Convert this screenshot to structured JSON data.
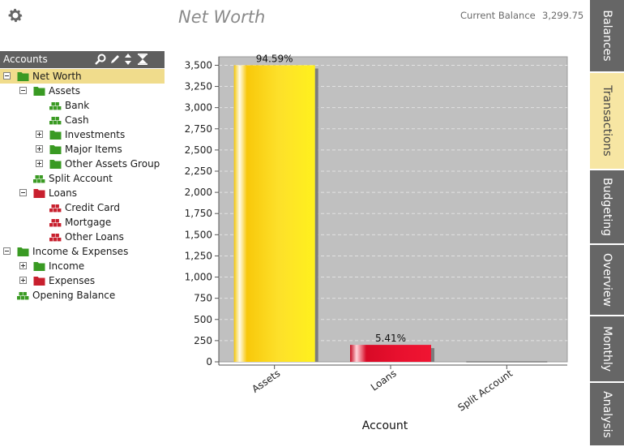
{
  "header": {
    "title": "Net Worth",
    "balance_label": "Current Balance",
    "balance_value": "3,299.75"
  },
  "accounts_panel": {
    "title": "Accounts"
  },
  "tree": [
    {
      "label": "Net Worth",
      "level": 0,
      "toggle": "minus",
      "icon": "folder",
      "color": "green",
      "selected": true
    },
    {
      "label": "Assets",
      "level": 1,
      "toggle": "minus",
      "icon": "folder",
      "color": "green"
    },
    {
      "label": "Bank",
      "level": 2,
      "toggle": "none",
      "icon": "account",
      "color": "green"
    },
    {
      "label": "Cash",
      "level": 2,
      "toggle": "none",
      "icon": "account",
      "color": "green"
    },
    {
      "label": "Investments",
      "level": 2,
      "toggle": "plus",
      "icon": "folder",
      "color": "green"
    },
    {
      "label": "Major Items",
      "level": 2,
      "toggle": "plus",
      "icon": "folder",
      "color": "green"
    },
    {
      "label": "Other Assets Group",
      "level": 2,
      "toggle": "plus",
      "icon": "folder",
      "color": "green"
    },
    {
      "label": "Split Account",
      "level": 1,
      "toggle": "none",
      "icon": "account",
      "color": "green"
    },
    {
      "label": "Loans",
      "level": 1,
      "toggle": "minus",
      "icon": "folder",
      "color": "red"
    },
    {
      "label": "Credit Card",
      "level": 2,
      "toggle": "none",
      "icon": "account",
      "color": "red"
    },
    {
      "label": "Mortgage",
      "level": 2,
      "toggle": "none",
      "icon": "account",
      "color": "red"
    },
    {
      "label": "Other Loans",
      "level": 2,
      "toggle": "none",
      "icon": "account",
      "color": "red"
    },
    {
      "label": "Income & Expenses",
      "level": 0,
      "toggle": "minus",
      "icon": "folder",
      "color": "green"
    },
    {
      "label": "Income",
      "level": 1,
      "toggle": "plus",
      "icon": "folder",
      "color": "green"
    },
    {
      "label": "Expenses",
      "level": 1,
      "toggle": "plus",
      "icon": "folder",
      "color": "red"
    },
    {
      "label": "Opening Balance",
      "level": 0,
      "toggle": "none",
      "icon": "account",
      "color": "green"
    }
  ],
  "tabs": [
    {
      "label": "Balances",
      "active": false
    },
    {
      "label": "Transactions",
      "active": true
    },
    {
      "label": "Budgeting",
      "active": false
    },
    {
      "label": "Overview",
      "active": false
    },
    {
      "label": "Monthly",
      "active": false
    },
    {
      "label": "Analysis",
      "active": false
    }
  ],
  "colors": {
    "green": "#3a9a23",
    "red": "#c8202e",
    "assets_bar": "#fbd90f",
    "loans_bar": "#e0102c",
    "plot_bg": "#c0c0c0"
  },
  "chart_data": {
    "type": "bar",
    "categories": [
      "Assets",
      "Loans",
      "Split Account"
    ],
    "values": [
      3500,
      200,
      0
    ],
    "data_labels": [
      "94.59%",
      "5.41%",
      ""
    ],
    "xlabel": "Account",
    "ylabel": "",
    "ylim": [
      0,
      3600
    ],
    "yticks": [
      0,
      250,
      500,
      750,
      1000,
      1250,
      1500,
      1750,
      2000,
      2250,
      2500,
      2750,
      3000,
      3250,
      3500
    ],
    "grid": true
  }
}
